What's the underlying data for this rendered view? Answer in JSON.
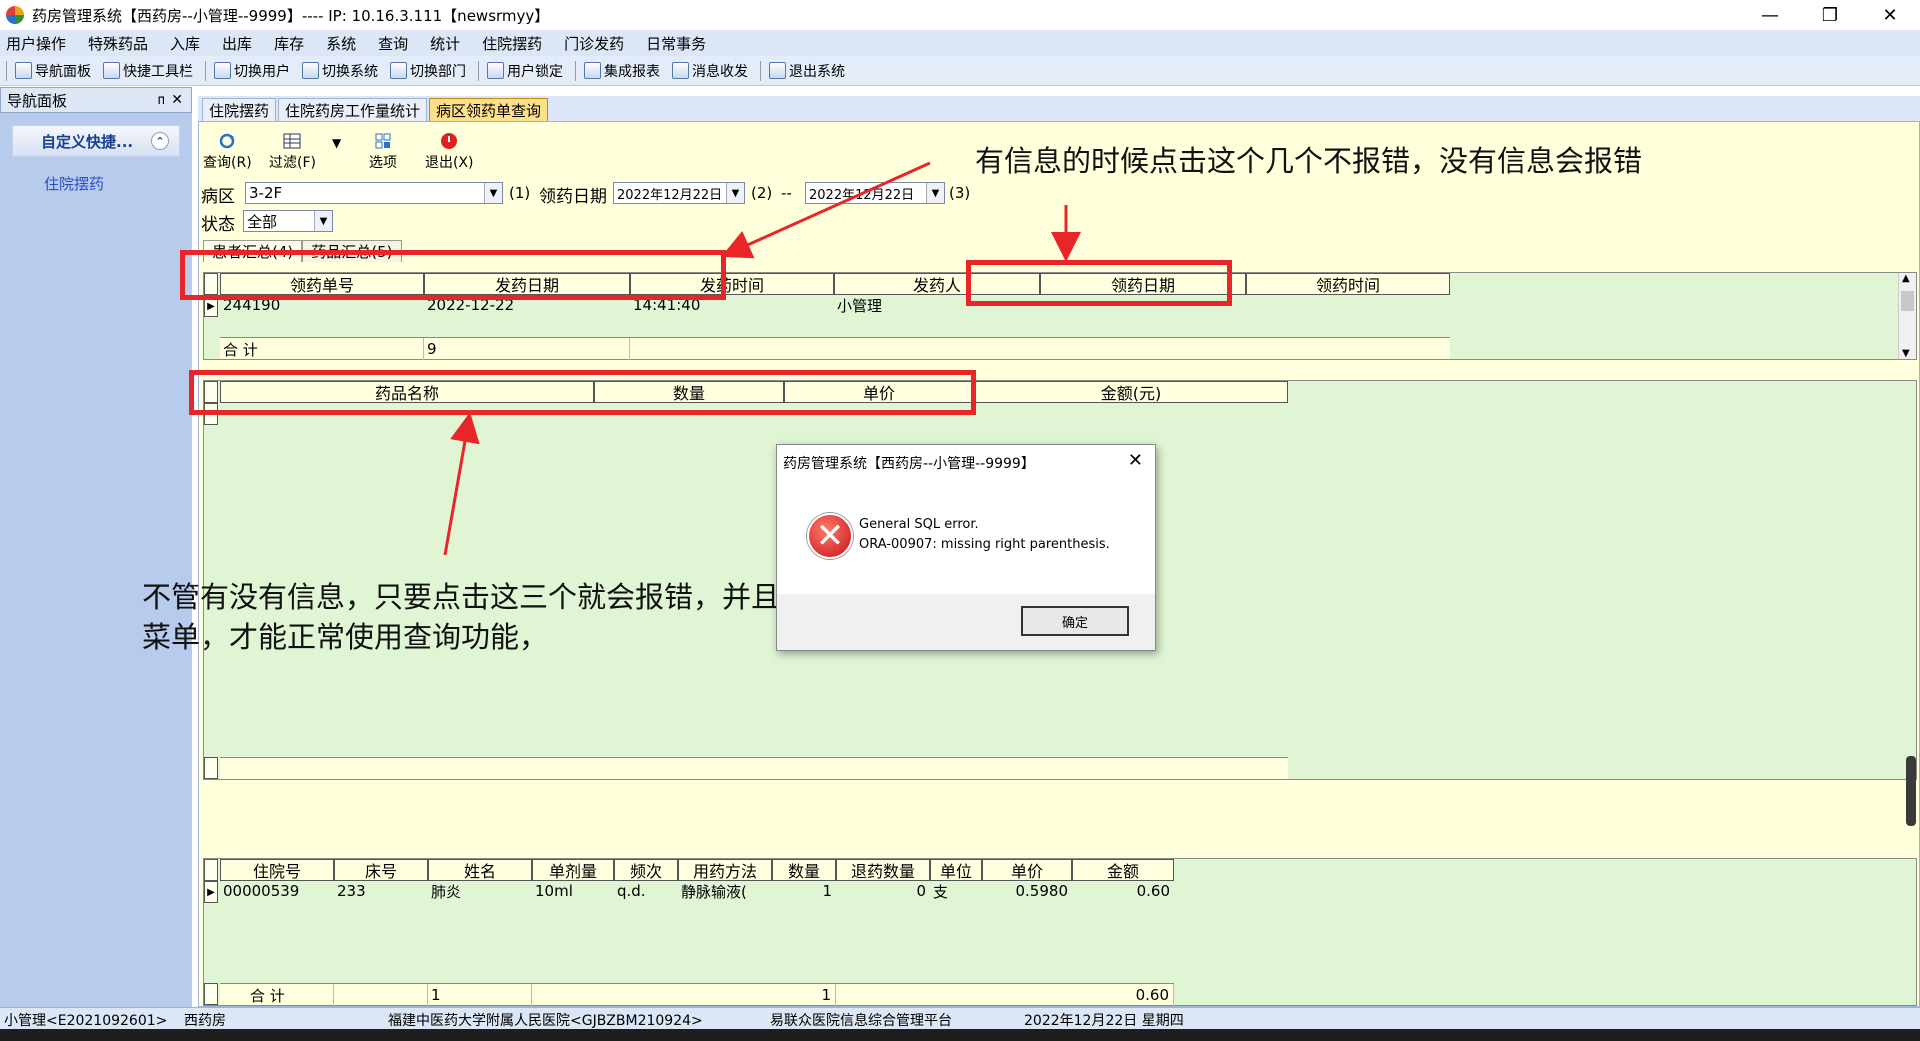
{
  "window": {
    "title": "药房管理系统【西药房--小管理--9999】---- IP:  10.16.3.111【newsrmyy】",
    "controls": {
      "minimize": "—",
      "restore": "❐",
      "close": "✕"
    }
  },
  "menu": [
    "用户操作",
    "特殊药品",
    "入库",
    "出库",
    "库存",
    "系统",
    "查询",
    "统计",
    "住院摆药",
    "门诊发药",
    "日常事务"
  ],
  "toolbar": [
    "导航面板",
    "快捷工具栏",
    "切换用户",
    "切换系统",
    "切换部门",
    "用户锁定",
    "集成报表",
    "消息收发",
    "退出系统"
  ],
  "nav": {
    "title": "导航面板",
    "pin": "ᴨ",
    "close": "✕",
    "group": "自定义快捷...",
    "item": "住院摆药"
  },
  "tabs": [
    "住院摆药",
    "住院药房工作量统计",
    "病区领药单查询"
  ],
  "inner_toolbar": {
    "query": "查询(R)",
    "filter": "过滤(F)",
    "options": "选项",
    "exit": "退出(X)"
  },
  "form": {
    "ward_label": "病区",
    "ward_value": "3-2F",
    "date_label": "领药日期",
    "p1": "(1)",
    "date1": "2022年12月22日",
    "p2": "(2)",
    "dash": "--",
    "date2": "2022年12月22日",
    "p3": "(3)",
    "status_label": "状态",
    "status_value": "全部"
  },
  "subtabs": [
    "患者汇总(4)",
    "药品汇总(5)"
  ],
  "grid1": {
    "headers": [
      "领药单号",
      "发药日期",
      "发药时间",
      "发药人",
      "领药日期",
      "领药时间"
    ],
    "row": [
      "244190",
      "2022-12-22",
      "14:41:40",
      "小管理",
      "",
      ""
    ],
    "sum_label": "合  计",
    "sum_value": "9"
  },
  "grid2": {
    "headers": [
      "药品名称",
      "数量",
      "单价",
      "金额(元)"
    ]
  },
  "grid3": {
    "headers": [
      "住院号",
      "床号",
      "姓名",
      "单剂量",
      "频次",
      "用药方法",
      "数量",
      "退药数量",
      "单位",
      "单价",
      "金额"
    ],
    "row": [
      "00000539",
      "233",
      "肺炎",
      "10ml",
      "q.d.",
      "静脉输液(",
      "1",
      "0",
      "支",
      "0.5980",
      "0.60"
    ],
    "sum_label": "合  计",
    "sum_name": "1",
    "sum_qty": "1",
    "sum_amount": "0.60"
  },
  "annotations": {
    "top": "有信息的时候点击这个几个不报错，没有信息会报错",
    "bottom_line1": "不管有没有信息，只要点击这三个就会报错，并且只能重新打开这个",
    "bottom_line2": "菜单，才能正常使用查询功能，"
  },
  "dialog": {
    "title": "药房管理系统【西药房--小管理--9999】",
    "close": "✕",
    "msg1": "General SQL error.",
    "msg2": "ORA-00907: missing right parenthesis.",
    "ok": "确定"
  },
  "status": [
    "小管理<E2021092601>",
    "西药房",
    "福建中医药大学附属人民医院<GJBZBM210924>",
    "易联众医院信息综合管理平台",
    "2022年12月22日 星期四"
  ],
  "colors": {
    "annotation_red": "#e8262a",
    "grid_green": "#dff5d4",
    "content_yellow": "#ffffdc",
    "nav_blue": "#b7cbec"
  }
}
